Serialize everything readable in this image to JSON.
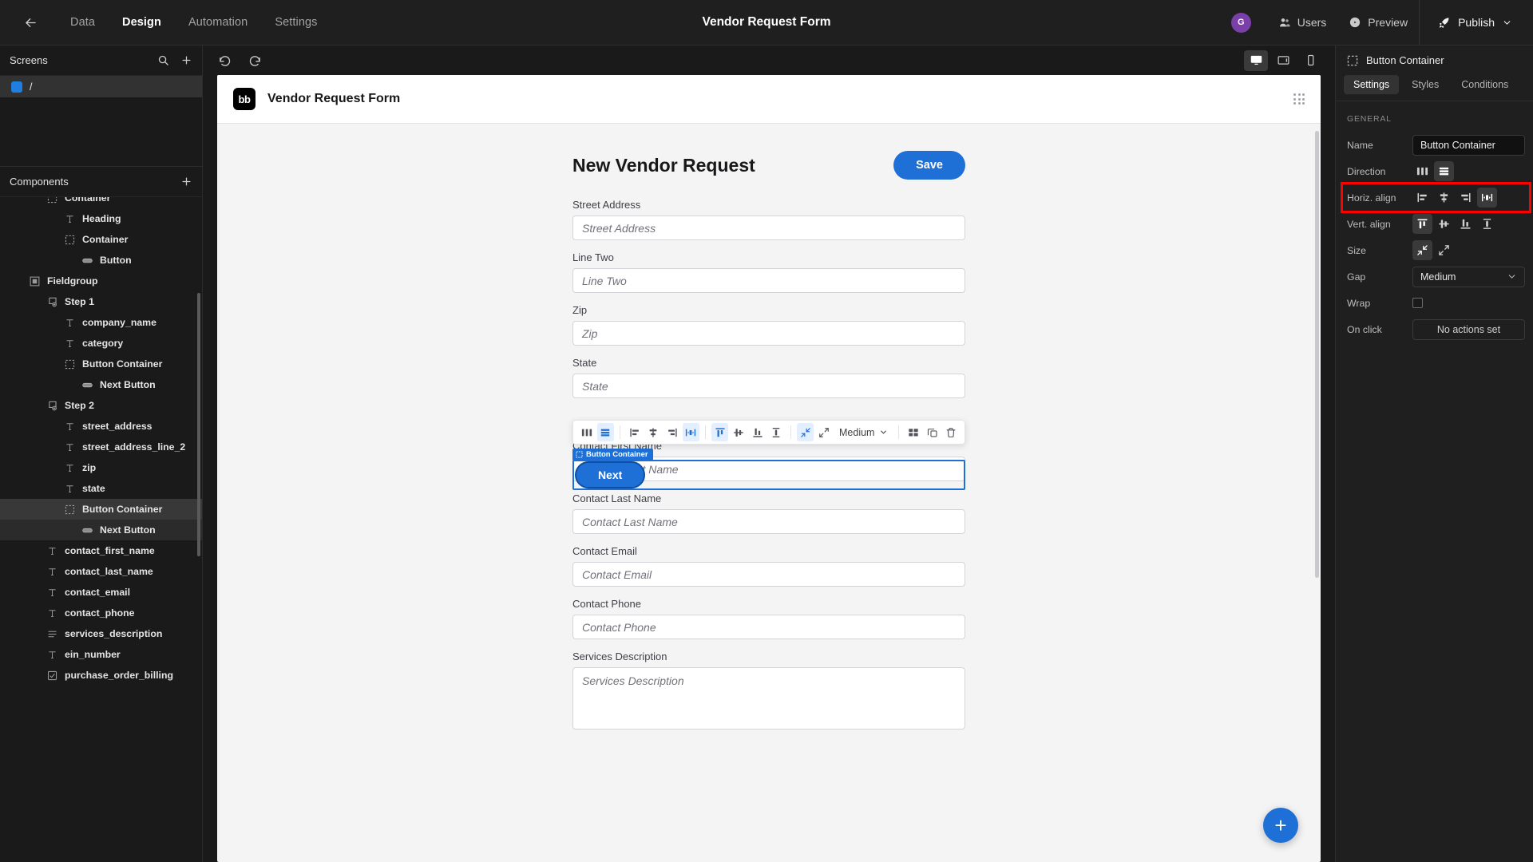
{
  "topbar": {
    "back_icon": "arrow-left-icon",
    "tabs": [
      {
        "label": "Data",
        "active": false
      },
      {
        "label": "Design",
        "active": true
      },
      {
        "label": "Automation",
        "active": false
      },
      {
        "label": "Settings",
        "active": false
      }
    ],
    "title": "Vendor Request Form",
    "avatar_initial": "G",
    "avatar_color": "#7b3fa9",
    "users_label": "Users",
    "preview_label": "Preview",
    "publish_label": "Publish"
  },
  "sidebar": {
    "screens": {
      "title": "Screens",
      "search_icon": "search-icon",
      "add_icon": "plus-icon",
      "items": [
        {
          "label": "/",
          "selected": true
        }
      ]
    },
    "components": {
      "title": "Components",
      "add_icon": "plus-icon",
      "tree": [
        {
          "label": "Container",
          "icon": "container-icon",
          "depth": 2,
          "state": "none"
        },
        {
          "label": "Heading",
          "icon": "text-icon",
          "depth": 3,
          "state": "none"
        },
        {
          "label": "Container",
          "icon": "container-icon",
          "depth": 3,
          "state": "none"
        },
        {
          "label": "Button",
          "icon": "button-icon",
          "depth": 4,
          "state": "none"
        },
        {
          "label": "Fieldgroup",
          "icon": "fieldgroup-icon",
          "depth": 1,
          "state": "none"
        },
        {
          "label": "Step 1",
          "icon": "step-icon",
          "depth": 2,
          "state": "none"
        },
        {
          "label": "company_name",
          "icon": "text-icon",
          "depth": 3,
          "state": "none"
        },
        {
          "label": "category",
          "icon": "text-icon",
          "depth": 3,
          "state": "none"
        },
        {
          "label": "Button Container",
          "icon": "container-icon",
          "depth": 3,
          "state": "none"
        },
        {
          "label": "Next Button",
          "icon": "button-icon",
          "depth": 4,
          "state": "none"
        },
        {
          "label": "Step 2",
          "icon": "step-icon",
          "depth": 2,
          "state": "none"
        },
        {
          "label": "street_address",
          "icon": "text-icon",
          "depth": 3,
          "state": "none"
        },
        {
          "label": "street_address_line_2",
          "icon": "text-icon",
          "depth": 3,
          "state": "none"
        },
        {
          "label": "zip",
          "icon": "text-icon",
          "depth": 3,
          "state": "none"
        },
        {
          "label": "state",
          "icon": "text-icon",
          "depth": 3,
          "state": "none"
        },
        {
          "label": "Button Container",
          "icon": "container-icon",
          "depth": 3,
          "state": "selected"
        },
        {
          "label": "Next Button",
          "icon": "button-icon",
          "depth": 4,
          "state": "child"
        },
        {
          "label": "contact_first_name",
          "icon": "text-icon",
          "depth": 2,
          "state": "none"
        },
        {
          "label": "contact_last_name",
          "icon": "text-icon",
          "depth": 2,
          "state": "none"
        },
        {
          "label": "contact_email",
          "icon": "text-icon",
          "depth": 2,
          "state": "none"
        },
        {
          "label": "contact_phone",
          "icon": "text-icon",
          "depth": 2,
          "state": "none"
        },
        {
          "label": "services_description",
          "icon": "textarea-icon",
          "depth": 2,
          "state": "none"
        },
        {
          "label": "ein_number",
          "icon": "text-icon",
          "depth": 2,
          "state": "none"
        },
        {
          "label": "purchase_order_billing",
          "icon": "checkbox-icon",
          "depth": 2,
          "state": "none"
        }
      ]
    }
  },
  "canvas_toolbar": {
    "undo_icon": "undo-icon",
    "redo_icon": "redo-icon",
    "devices": [
      {
        "name": "desktop-icon",
        "active": true
      },
      {
        "name": "tablet-icon",
        "active": false
      },
      {
        "name": "mobile-icon",
        "active": false
      }
    ]
  },
  "canvas": {
    "logo_text": "bb",
    "app_title": "Vendor Request Form",
    "grid_icon": "dots-grid-icon",
    "form": {
      "title": "New Vendor Request",
      "save_label": "Save",
      "fields": [
        {
          "label": "Street Address",
          "placeholder": "Street Address",
          "type": "text"
        },
        {
          "label": "Line Two",
          "placeholder": "Line Two",
          "type": "text"
        },
        {
          "label": "Zip",
          "placeholder": "Zip",
          "type": "text"
        },
        {
          "label": "State",
          "placeholder": "State",
          "type": "text"
        },
        {
          "label": "Contact First Name",
          "placeholder": "Contact First Name",
          "type": "text"
        },
        {
          "label": "Contact Last Name",
          "placeholder": "Contact Last Name",
          "type": "text"
        },
        {
          "label": "Contact Email",
          "placeholder": "Contact Email",
          "type": "text"
        },
        {
          "label": "Contact Phone",
          "placeholder": "Contact Phone",
          "type": "text"
        },
        {
          "label": "Services Description",
          "placeholder": "Services Description",
          "type": "textarea"
        }
      ],
      "selected_tag": "Button Container",
      "next_label": "Next",
      "fab_icon": "plus-icon"
    },
    "element_toolbar": {
      "direction": [
        {
          "name": "direction-columns-icon",
          "active": false
        },
        {
          "name": "direction-rows-icon",
          "active": true
        }
      ],
      "horiz_align": [
        {
          "name": "align-left-icon",
          "active": false
        },
        {
          "name": "align-center-icon",
          "active": false
        },
        {
          "name": "align-right-icon",
          "active": false
        },
        {
          "name": "align-space-between-icon",
          "active": true
        }
      ],
      "vert_align": [
        {
          "name": "valign-top-icon",
          "active": true
        },
        {
          "name": "valign-middle-icon",
          "active": false
        },
        {
          "name": "valign-bottom-icon",
          "active": false
        },
        {
          "name": "valign-space-between-icon",
          "active": false
        }
      ],
      "size": [
        {
          "name": "size-shrink-icon",
          "active": true
        },
        {
          "name": "size-grow-icon",
          "active": false
        }
      ],
      "gap_value": "Medium",
      "extra": [
        {
          "name": "layout-grid-icon",
          "active": false
        },
        {
          "name": "duplicate-icon",
          "active": false
        },
        {
          "name": "delete-icon",
          "active": false
        }
      ]
    }
  },
  "rightpanel": {
    "header_icon": "container-icon",
    "header_title": "Button Container",
    "tabs": [
      {
        "label": "Settings",
        "active": true
      },
      {
        "label": "Styles",
        "active": false
      },
      {
        "label": "Conditions",
        "active": false
      }
    ],
    "section_title": "GENERAL",
    "rows": {
      "name_label": "Name",
      "name_value": "Button Container",
      "direction_label": "Direction",
      "direction": [
        {
          "name": "direction-columns-icon",
          "active": false
        },
        {
          "name": "direction-rows-icon",
          "active": true
        }
      ],
      "horiz_label": "Horiz. align",
      "horiz": [
        {
          "name": "align-left-icon",
          "active": false
        },
        {
          "name": "align-center-icon",
          "active": false
        },
        {
          "name": "align-right-icon",
          "active": false
        },
        {
          "name": "align-space-between-icon",
          "active": true
        }
      ],
      "vert_label": "Vert. align",
      "vert": [
        {
          "name": "valign-top-icon",
          "active": true
        },
        {
          "name": "valign-middle-icon",
          "active": false
        },
        {
          "name": "valign-bottom-icon",
          "active": false
        },
        {
          "name": "valign-space-between-icon",
          "active": false
        }
      ],
      "size_label": "Size",
      "size": [
        {
          "name": "size-shrink-icon",
          "active": true
        },
        {
          "name": "size-grow-icon",
          "active": false
        }
      ],
      "gap_label": "Gap",
      "gap_value": "Medium",
      "wrap_label": "Wrap",
      "wrap_checked": false,
      "onclick_label": "On click",
      "onclick_value": "No actions set"
    },
    "annotation_color": "#ff0000"
  }
}
